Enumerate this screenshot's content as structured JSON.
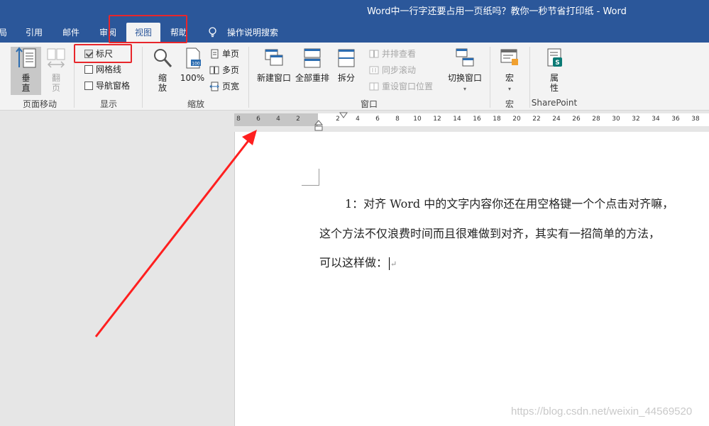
{
  "window": {
    "title": "Word中一行字还要占用一页纸吗？教你一秒节省打印纸  -  Word"
  },
  "tabs": [
    {
      "label": "局"
    },
    {
      "label": "引用"
    },
    {
      "label": "邮件"
    },
    {
      "label": "审阅"
    },
    {
      "label": "视图",
      "active": true
    },
    {
      "label": "帮助"
    },
    {
      "label": "操作说明搜索",
      "icon": "lightbulb-icon"
    }
  ],
  "ribbon": {
    "page_move": {
      "label": "页面移动",
      "vertical": "垂\n直",
      "flip": "翻\n页"
    },
    "show": {
      "label": "显示",
      "ruler": {
        "label": "标尺",
        "checked": true
      },
      "gridlines": {
        "label": "网格线",
        "checked": false
      },
      "nav_pane": {
        "label": "导航窗格",
        "checked": false
      }
    },
    "zoom": {
      "label": "缩放",
      "zoom": "缩\n放",
      "hundred": "100%",
      "one_page": "单页",
      "multi_page": "多页",
      "page_width": "页宽"
    },
    "window": {
      "label": "窗口",
      "new_window": "新建窗口",
      "arrange_all": "全部重排",
      "split": "拆分",
      "side_by_side": "并排查看",
      "sync_scroll": "同步滚动",
      "reset_position": "重设窗口位置",
      "switch_windows": "切换窗口"
    },
    "macros": {
      "label": "宏",
      "macros": "宏"
    },
    "sharepoint": {
      "label": "SharePoint",
      "properties": "属\n性"
    }
  },
  "ruler": {
    "left_labels": [
      "8",
      "6",
      "4",
      "2"
    ],
    "right_labels": [
      "2",
      "4",
      "6",
      "8",
      "10",
      "12",
      "14",
      "16",
      "18",
      "20",
      "22",
      "24",
      "26",
      "28",
      "30",
      "32",
      "34",
      "36",
      "38"
    ]
  },
  "document": {
    "lines": [
      "1：对齐 Word 中的文字内容你还在用空格键一个个点击对齐嘛，",
      "这个方法不仅浪费时间而且很难做到对齐，其实有一招简单的方法，",
      "可以这样做："
    ]
  },
  "watermark": "https://blog.csdn.net/weixin_44569520",
  "colors": {
    "titlebar": "#2b579a",
    "ribbon": "#f3f3f3",
    "annotation": "#e8262b"
  }
}
